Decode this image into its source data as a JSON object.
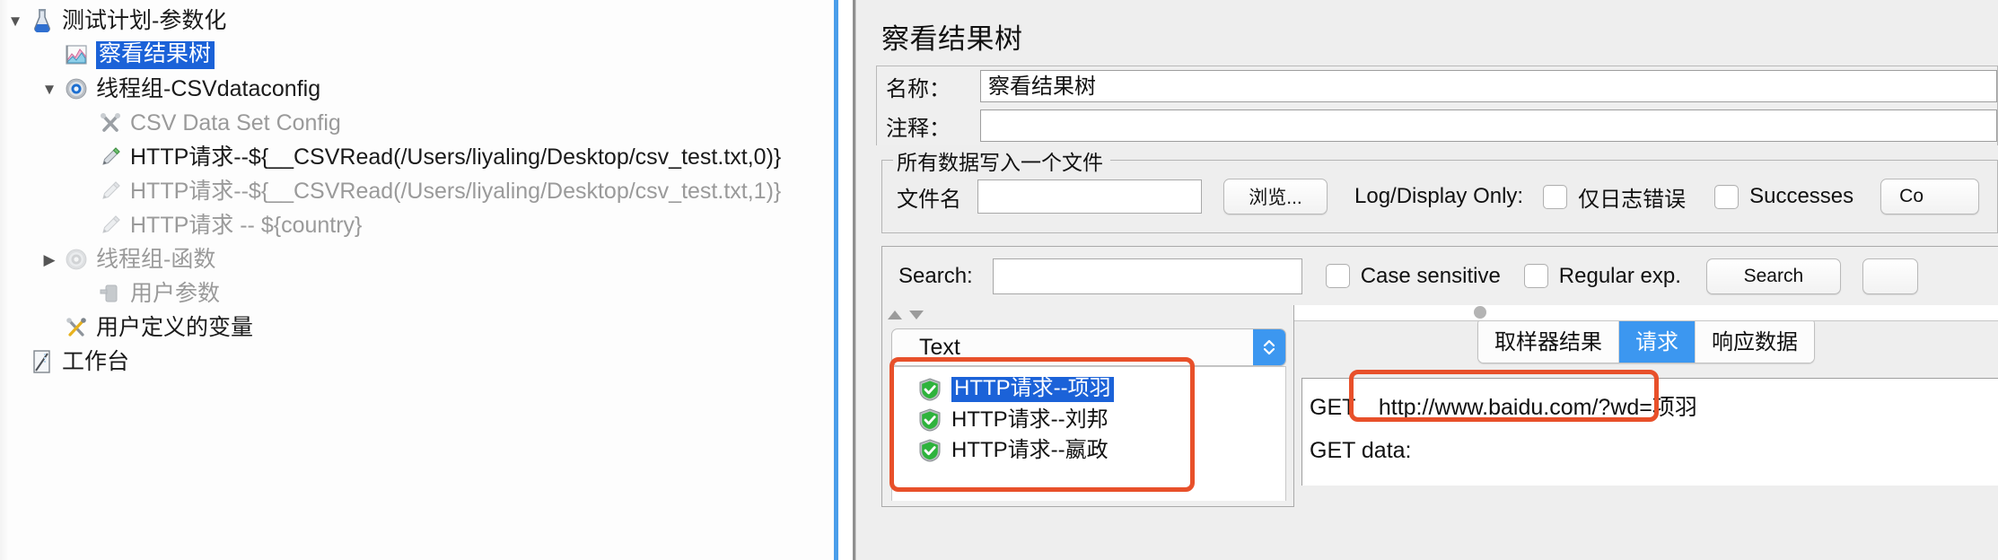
{
  "tree": {
    "items": [
      {
        "label": "测试计划-参数化",
        "icon": "test-plan-flask-icon",
        "twisty": "▼",
        "indent": 0,
        "dim": false,
        "selected": false
      },
      {
        "label": "察看结果树",
        "icon": "view-results-tree-chart-icon",
        "twisty": "",
        "indent": 1,
        "dim": false,
        "selected": true
      },
      {
        "label": "线程组-CSVdataconfig",
        "icon": "thread-group-gear-icon",
        "twisty": "▼",
        "indent": 1,
        "dim": false,
        "selected": false
      },
      {
        "label": "CSV Data Set Config",
        "icon": "config-element-tools-icon",
        "twisty": "",
        "indent": 2,
        "dim": true,
        "selected": false
      },
      {
        "label": "HTTP请求--${__CSVRead(/Users/liyaling/Desktop/csv_test.txt,0)}",
        "icon": "http-sampler-pen-icon",
        "twisty": "",
        "indent": 2,
        "dim": false,
        "selected": false
      },
      {
        "label": "HTTP请求--${__CSVRead(/Users/liyaling/Desktop/csv_test.txt,1)}",
        "icon": "http-sampler-pen-icon-disabled",
        "twisty": "",
        "indent": 2,
        "dim": true,
        "selected": false
      },
      {
        "label": "HTTP请求 -- ${country}",
        "icon": "http-sampler-pen-icon-disabled",
        "twisty": "",
        "indent": 2,
        "dim": true,
        "selected": false
      },
      {
        "label": "线程组-函数",
        "icon": "thread-group-gear-icon-disabled",
        "twisty": "▶",
        "indent": 1,
        "dim": true,
        "selected": false
      },
      {
        "label": "用户参数",
        "icon": "user-parameters-icon",
        "twisty": "",
        "indent": 2,
        "dim": true,
        "selected": false
      },
      {
        "label": "用户定义的变量",
        "icon": "user-defined-variables-tools-icon",
        "twisty": "",
        "indent": 1,
        "dim": false,
        "selected": false
      },
      {
        "label": "工作台",
        "icon": "workbench-icon",
        "twisty": "",
        "indent": 0,
        "dim": false,
        "selected": false
      }
    ]
  },
  "right": {
    "panel_title": "察看结果树",
    "name_label": "名称：",
    "name_value": "察看结果树",
    "comment_label": "注释：",
    "comment_value": "",
    "group": {
      "legend": "所有数据写入一个文件",
      "filename_label": "文件名",
      "filename_value": "",
      "browse_button": "浏览...",
      "log_display_only_label": "Log/Display Only:",
      "errors_only_label": "仅日志错误",
      "successes_label": "Successes",
      "configure_button": "Co"
    },
    "search": {
      "label": "Search:",
      "value": "",
      "case_sensitive_label": "Case sensitive",
      "regular_exp_label": "Regular exp.",
      "search_button": "Search"
    },
    "results": {
      "render_selector_value": "Text",
      "items": [
        {
          "label": "HTTP请求--项羽",
          "status": "success",
          "selected": true
        },
        {
          "label": "HTTP请求--刘邦",
          "status": "success",
          "selected": false
        },
        {
          "label": "HTTP请求--嬴政",
          "status": "success",
          "selected": false
        }
      ]
    },
    "tabs": [
      {
        "label": "取样器结果",
        "active": false
      },
      {
        "label": "请求",
        "active": true
      },
      {
        "label": "响应数据",
        "active": false
      }
    ],
    "request": {
      "method": "GET",
      "url": "http://www.baidu.com/?wd=项羽",
      "get_data_label": "GET data:"
    }
  },
  "colors": {
    "selection_blue": "#1b62d8",
    "tab_active_blue": "#3c97f0",
    "divider_blue": "#4a9eea",
    "highlight_red": "#e8502a",
    "success_green": "#34a83c"
  }
}
